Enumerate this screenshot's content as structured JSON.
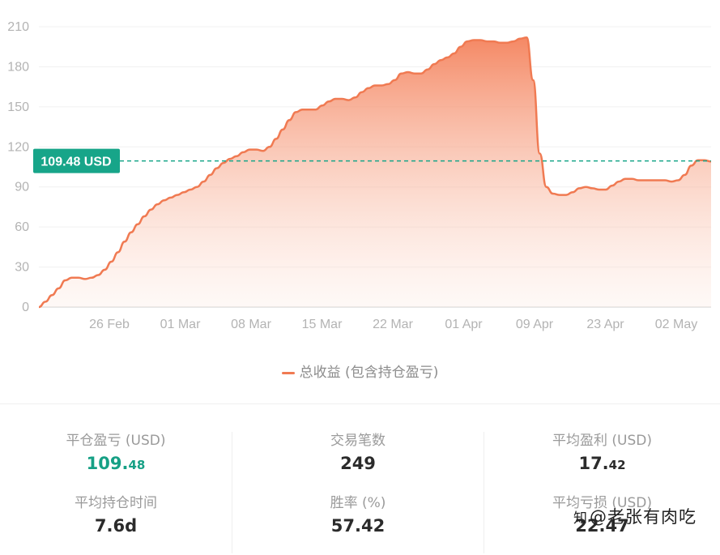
{
  "chart_data": {
    "type": "area",
    "ylim": [
      0,
      210
    ],
    "yticks": [
      "0",
      "30",
      "60",
      "90",
      "120",
      "150",
      "180",
      "210"
    ],
    "xtick_labels": [
      "26 Feb",
      "01 Mar",
      "08 Mar",
      "15 Mar",
      "22 Mar",
      "01 Apr",
      "09 Apr",
      "23 Apr",
      "02 May"
    ],
    "grid": true,
    "legend_position": "bottom-center",
    "series": [
      {
        "name": "总收益 (包含持仓盈亏)",
        "color": "#f07a52",
        "values": [
          0,
          4,
          9,
          14,
          20,
          22,
          22,
          21,
          22,
          24,
          28,
          34,
          41,
          49,
          56,
          62,
          68,
          73,
          77,
          80,
          82,
          84,
          86,
          88,
          90,
          94,
          99,
          104,
          108,
          111,
          113,
          116,
          118,
          118,
          117,
          120,
          126,
          133,
          140,
          146,
          148,
          148,
          148,
          151,
          154,
          156,
          156,
          155,
          157,
          161,
          164,
          166,
          166,
          167,
          170,
          175,
          176,
          175,
          175,
          178,
          182,
          185,
          187,
          190,
          195,
          199,
          200,
          200,
          199,
          199,
          198,
          198,
          199,
          201,
          202,
          170,
          115,
          90,
          85,
          84,
          84,
          86,
          89,
          90,
          89,
          88,
          88,
          91,
          94,
          96,
          96,
          95,
          95,
          95,
          95,
          95,
          94,
          95,
          99,
          106,
          110,
          110,
          109
        ]
      }
    ],
    "reference_line": {
      "value": 109.48,
      "label": "109.48 USD",
      "color": "#17a589"
    }
  },
  "stats": [
    {
      "label": "平仓盈亏 (USD)",
      "int": "109.",
      "dec": "48",
      "color": "green"
    },
    {
      "label": "交易笔数",
      "int": "249",
      "dec": ""
    },
    {
      "label": "平均盈利 (USD)",
      "int": "17.",
      "dec": "42"
    },
    {
      "label": "平均持仓时间",
      "int": "7.6d",
      "dec": ""
    },
    {
      "label": "胜率 (%)",
      "int": "57.42",
      "dec": ""
    },
    {
      "label": "平均亏损 (USD)",
      "int": "22.47",
      "dec": ""
    }
  ],
  "watermark": {
    "mark": "知",
    "text": "@老张有肉吃"
  }
}
